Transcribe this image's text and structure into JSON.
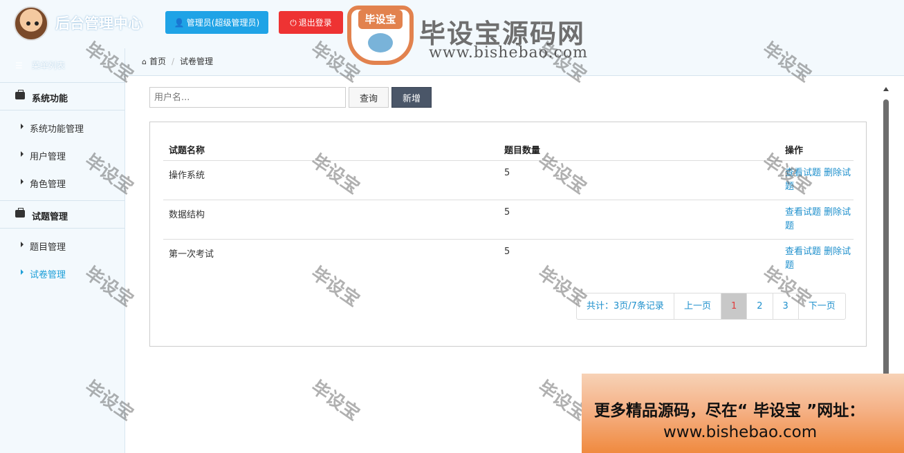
{
  "header": {
    "app_title": "后台管理中心",
    "admin_button": "管理员(超级管理员)",
    "logout_button": "退出登录",
    "logo_badge": "毕设宝",
    "logo_text": "毕设宝源码网",
    "logo_url": "www.bishebao.com"
  },
  "sidebar": {
    "menu_list_label": "菜单列表",
    "groups": [
      {
        "label": "系统功能",
        "items": [
          "系统功能管理",
          "用户管理",
          "角色管理"
        ]
      },
      {
        "label": "试题管理",
        "items": [
          "题目管理",
          "试卷管理"
        ]
      }
    ],
    "active_item": "试卷管理"
  },
  "breadcrumb": {
    "home": "首页",
    "current": "试卷管理"
  },
  "toolbar": {
    "search_placeholder": "用户名...",
    "query_button": "查询",
    "add_button": "新增"
  },
  "table": {
    "headers": [
      "试题名称",
      "题目数量",
      "操作"
    ],
    "rows": [
      {
        "name": "操作系统",
        "count": "5",
        "view": "查看试题",
        "delete": "删除试题"
      },
      {
        "name": "数据结构",
        "count": "5",
        "view": "查看试题",
        "delete": "删除试题"
      },
      {
        "name": "第一次考试",
        "count": "5",
        "view": "查看试题",
        "delete": "删除试题"
      }
    ]
  },
  "pager": {
    "summary": "共计：3页/7条记录",
    "prev": "上一页",
    "pages": [
      "1",
      "2",
      "3"
    ],
    "current": "1",
    "next": "下一页"
  },
  "watermark_text": "毕设宝",
  "ad": {
    "line1": "更多精品源码，尽在“ 毕设宝 ”网址：",
    "line2": "www.bishebao.com"
  },
  "colors": {
    "accent_blue": "#1fa3e6",
    "danger_red": "#ee3333",
    "link_blue": "#1d8fcc",
    "dark_button": "#4a5668"
  }
}
